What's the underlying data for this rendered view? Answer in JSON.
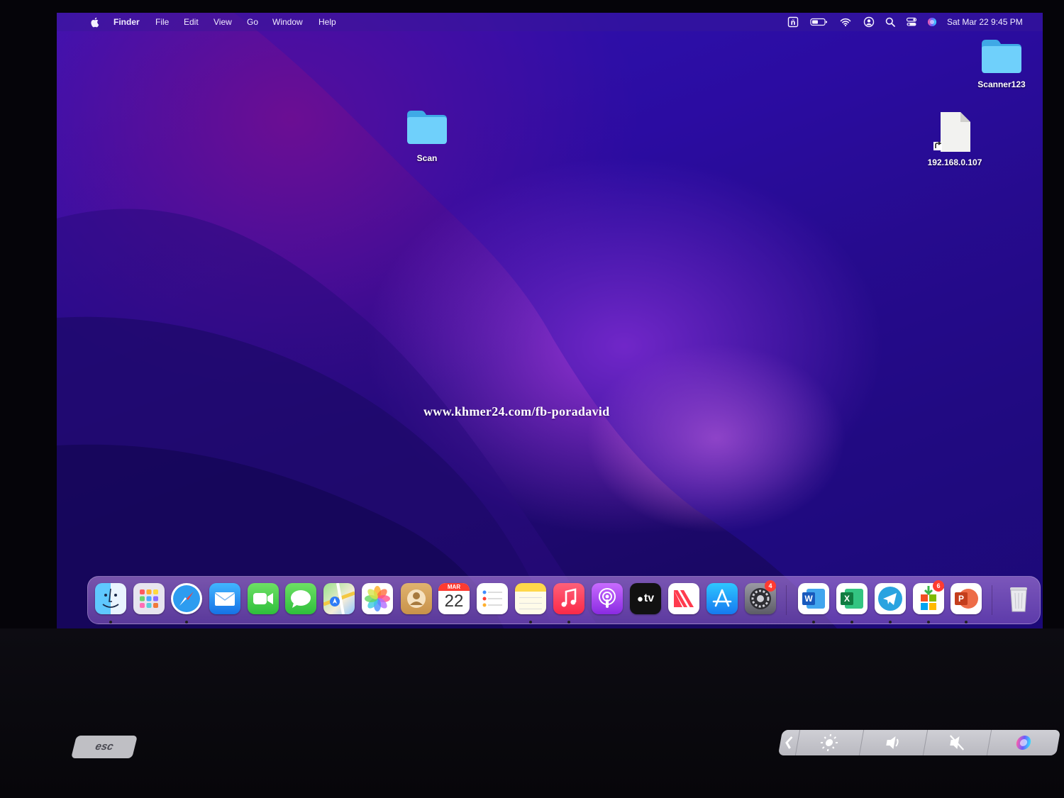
{
  "menubar": {
    "apple_icon": "apple-icon",
    "app_name": "Finder",
    "menus": [
      "File",
      "Edit",
      "View",
      "Go",
      "Window",
      "Help"
    ],
    "status_icons": [
      "font-icon",
      "battery-icon",
      "wifi-icon",
      "user-icon",
      "search-icon",
      "control-center-icon",
      "siri-icon"
    ],
    "clock": "Sat Mar 22  9:45 PM"
  },
  "desktop": {
    "items": [
      {
        "type": "folder",
        "label": "Scan"
      },
      {
        "type": "folder",
        "label": "Scanner123"
      },
      {
        "type": "alias-document",
        "label": "192.168.0.107"
      }
    ],
    "watermark": "www.khmer24.com/fb-poradavid"
  },
  "dock": {
    "apps": [
      {
        "name": "Finder",
        "running": true
      },
      {
        "name": "Launchpad",
        "running": false
      },
      {
        "name": "Safari",
        "running": true
      },
      {
        "name": "Mail",
        "running": false
      },
      {
        "name": "FaceTime",
        "running": false
      },
      {
        "name": "Messages",
        "running": false
      },
      {
        "name": "Maps",
        "running": false
      },
      {
        "name": "Photos",
        "running": false
      },
      {
        "name": "Contacts",
        "running": false
      },
      {
        "name": "Calendar",
        "running": false,
        "month": "MAR",
        "day": "22"
      },
      {
        "name": "Reminders",
        "running": false
      },
      {
        "name": "Notes",
        "running": true
      },
      {
        "name": "Music",
        "running": true
      },
      {
        "name": "Podcasts",
        "running": false
      },
      {
        "name": "TV",
        "running": false,
        "label": "tv"
      },
      {
        "name": "News",
        "running": false
      },
      {
        "name": "App Store",
        "running": false
      },
      {
        "name": "System Preferences",
        "running": false,
        "badge": "4"
      },
      {
        "name": "Microsoft Word",
        "running": true
      },
      {
        "name": "Microsoft Excel",
        "running": true
      },
      {
        "name": "Telegram",
        "running": true
      },
      {
        "name": "Microsoft AutoUpdate",
        "running": true,
        "badge": "6"
      },
      {
        "name": "Microsoft PowerPoint",
        "running": true
      },
      {
        "name": "Trash",
        "running": false
      }
    ]
  },
  "keyboard": {
    "esc_label": "esc",
    "touchbar_icons": [
      "chevron-left-icon",
      "brightness-icon",
      "volume-icon",
      "mute-icon",
      "siri-icon"
    ]
  },
  "colors": {
    "wallpaper_dark": "#1c086a",
    "wallpaper_accent": "#e070e0",
    "folder_blue": "#5ac8f5",
    "badge_red": "#ff3b30"
  }
}
